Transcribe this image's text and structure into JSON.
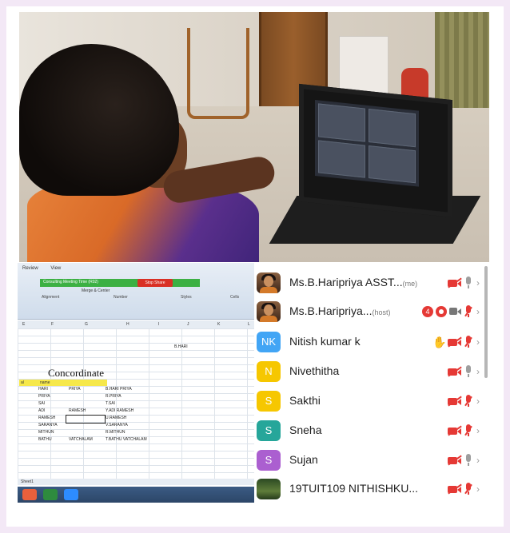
{
  "spreadsheet": {
    "ribbon_tabs": [
      "Review",
      "View"
    ],
    "meeting_bar": "Consulting Meeting Time (R02)",
    "stop_share": "Stop Share",
    "toolbar_merge": "Merge & Center",
    "groups": [
      "Alignment",
      "Number",
      "Styles",
      "Cells"
    ],
    "columns": [
      "E",
      "F",
      "G",
      "H",
      "I",
      "J",
      "K",
      "L"
    ],
    "cell_ref": "B.HARI",
    "heading": "Concordinate",
    "name_header": [
      "al",
      "name"
    ],
    "rows": [
      [
        "HARI",
        "PRIYA",
        "B.HARI PRIYA"
      ],
      [
        "PRIYA",
        "",
        "R.PRIYA"
      ],
      [
        "SAI",
        "",
        "T.SAI"
      ],
      [
        "ADI",
        "RAMESH",
        "Y.ADI RAMESH"
      ],
      [
        "RAMESH",
        "",
        "U.RAMESH"
      ],
      [
        "SARANYA",
        "",
        "V.SARANYA"
      ],
      [
        "MITHUN",
        "",
        "R.MITHUN"
      ],
      [
        "BATHU",
        "VATCHALAM",
        "T.BATHU VATCHALAM"
      ]
    ],
    "sheet_tab": "Sheet1"
  },
  "participants": [
    {
      "name": "Ms.B.Haripriya ASST...",
      "tag": "(me)",
      "avatar": "photo",
      "avatar_color": "#8a6040",
      "hand": false,
      "badge": "",
      "recording": false,
      "cam": "off",
      "mic": "on"
    },
    {
      "name": "Ms.B.Haripriya...",
      "tag": "(host)",
      "avatar": "photo",
      "avatar_color": "#8a6040",
      "hand": false,
      "badge": "4",
      "recording": true,
      "cam": "on",
      "mic": "off"
    },
    {
      "name": "Nitish kumar k",
      "tag": "",
      "avatar": "NK",
      "avatar_color": "#42a5f5",
      "hand": true,
      "badge": "",
      "recording": false,
      "cam": "off",
      "mic": "off"
    },
    {
      "name": "Nivethitha",
      "tag": "",
      "avatar": "N",
      "avatar_color": "#f6c700",
      "hand": false,
      "badge": "",
      "recording": false,
      "cam": "off",
      "mic": "on"
    },
    {
      "name": "Sakthi",
      "tag": "",
      "avatar": "S",
      "avatar_color": "#f6c700",
      "hand": false,
      "badge": "",
      "recording": false,
      "cam": "off",
      "mic": "off"
    },
    {
      "name": "Sneha",
      "tag": "",
      "avatar": "S",
      "avatar_color": "#26a69a",
      "hand": false,
      "badge": "",
      "recording": false,
      "cam": "off",
      "mic": "off"
    },
    {
      "name": "Sujan",
      "tag": "",
      "avatar": "S",
      "avatar_color": "#ab5fd0",
      "hand": false,
      "badge": "",
      "recording": false,
      "cam": "off",
      "mic": "on"
    },
    {
      "name": "19TUIT109 NITHISHKU...",
      "tag": "",
      "avatar": "team",
      "avatar_color": "#3e5a2c",
      "hand": false,
      "badge": "",
      "recording": false,
      "cam": "off",
      "mic": "off"
    }
  ],
  "colors": {
    "mic_off": "#e53935",
    "mic_on": "#9e9e9e",
    "cam_off": "#e53935"
  }
}
